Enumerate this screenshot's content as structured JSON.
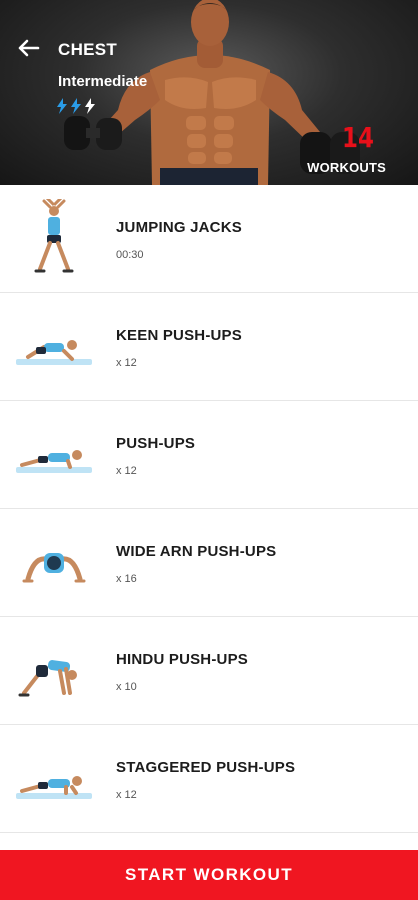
{
  "header": {
    "title": "CHEST",
    "level": "Intermediate",
    "intensity_icon": "bolt-icon",
    "workout_count": "14",
    "workout_count_label": "WORKOUTS",
    "count_color": "#e8101a"
  },
  "exercises": [
    {
      "name": "JUMPING JACKS",
      "meta": "00:30",
      "thumb": "jumping-jacks"
    },
    {
      "name": "KEEN PUSH-UPS",
      "meta": "x 12",
      "thumb": "knee-pushup"
    },
    {
      "name": "PUSH-UPS",
      "meta": "x 12",
      "thumb": "pushup"
    },
    {
      "name": "WIDE ARN PUSH-UPS",
      "meta": "x 16",
      "thumb": "wide-pushup"
    },
    {
      "name": "HINDU PUSH-UPS",
      "meta": "x 10",
      "thumb": "hindu-pushup"
    },
    {
      "name": "STAGGERED PUSH-UPS",
      "meta": "x 12",
      "thumb": "staggered-pushup"
    }
  ],
  "footer": {
    "start_label": "START WORKOUT",
    "accent": "#f01621"
  }
}
